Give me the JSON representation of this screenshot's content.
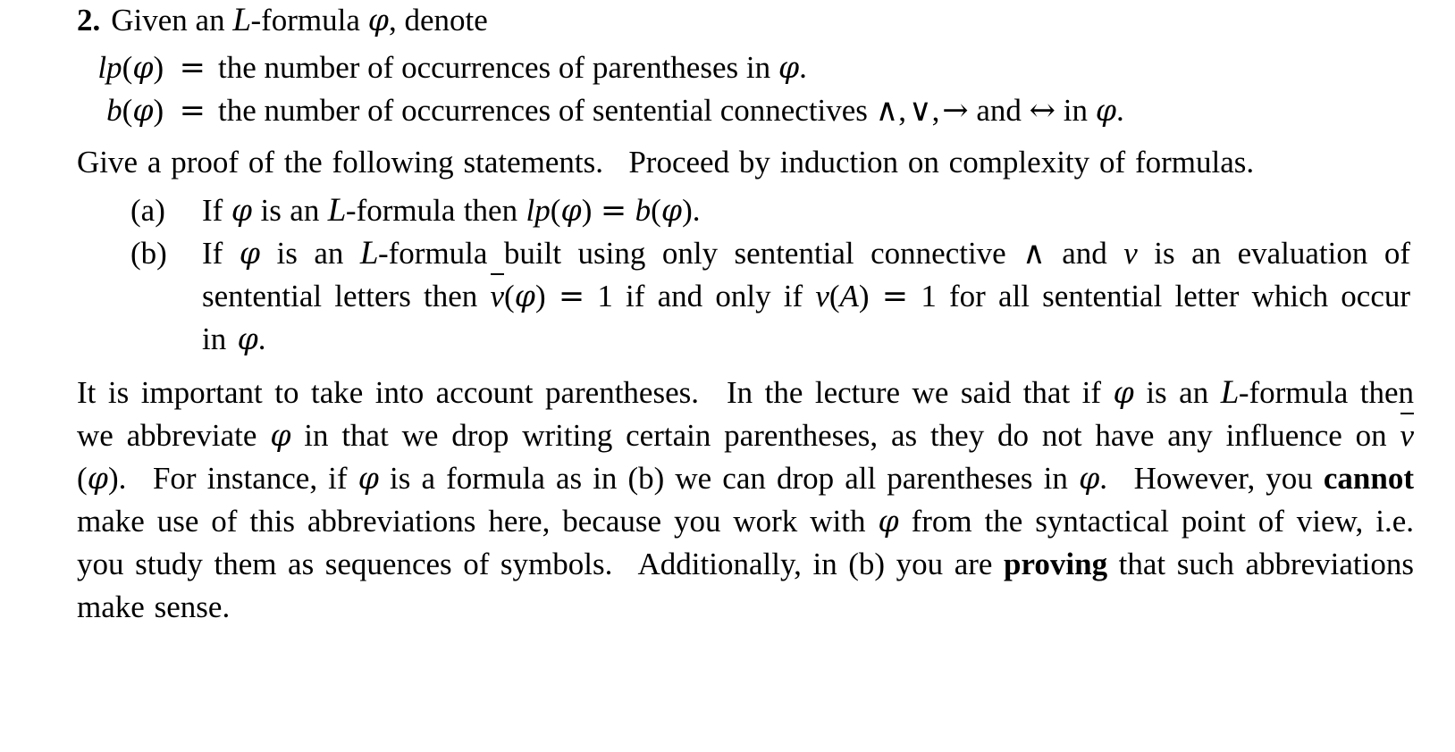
{
  "document": {
    "problem_number": "2.",
    "header_text_parts": {
      "before": "Given an ",
      "script_l": "L",
      "middle": "-formula ",
      "phi": "φ",
      "after": ", denote"
    },
    "definitions": [
      {
        "lhs_name": "lp",
        "lhs": "lp(φ)  =",
        "rhs": "the number of occurrences of parentheses in φ."
      },
      {
        "lhs_name": "b",
        "lhs": "b(φ)  =",
        "rhs": "the number of occurrences of sentential connectives ∧, ∨, → and ↔ in φ."
      }
    ],
    "instruction": "Give a proof of the following statements.  Proceed by induction on complexity of formulas.",
    "items": [
      {
        "label": "(a)",
        "text": "If φ is an 𝐿-formula then lp(φ) = b(φ)."
      },
      {
        "label": "(b)",
        "text": "If φ is an 𝐿-formula built using only sentential connective ∧ and v is an evaluation of sentential letters then v̄(φ) = 1 if and only if v(A) = 1 for all sentential letter which occur in φ."
      }
    ],
    "closing_paragraph": "It is important to take into account parentheses.  In the lecture we said that if φ is an 𝐿-formula then we abbreviate φ in that we drop writing certain parentheses, as they do not have any influence on v̄(φ).  For instance, if φ is a formula as in (b) we can drop all parentheses in φ.  However, you cannot make use of this abbreviations here, because you work with φ from the syntactical point of view, i.e. you study them as sequences of symbols.  Additionally, in (b) you are proving that such abbreviations make sense.",
    "emphasis_words": [
      "cannot",
      "proving"
    ],
    "symbols": {
      "and": "∧",
      "or": "∨",
      "implies": "→",
      "iff": "↔",
      "phi": "φ",
      "script_l": "L",
      "equals": "=",
      "one": "1",
      "letter_A": "A",
      "valuation": "v",
      "valuation_bar": "v̄"
    },
    "colors": {
      "text": "#000000",
      "background": "#ffffff"
    }
  }
}
